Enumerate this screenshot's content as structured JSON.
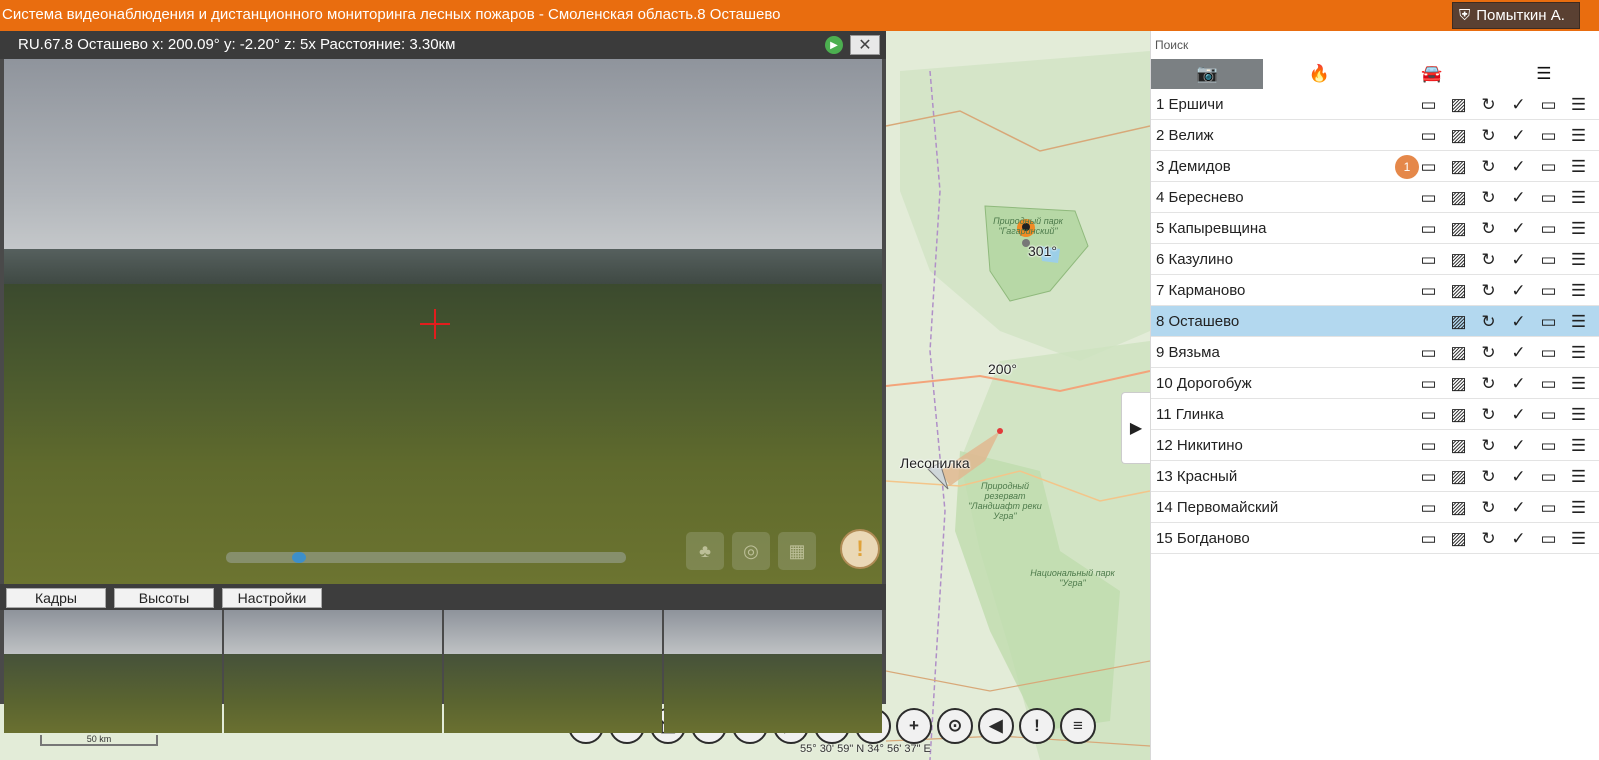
{
  "app": {
    "title": "Система видеонаблюдения и дистанционного мониторинга лесных пожаров - Смоленская область.8 Осташево",
    "user": "Помыткин А.",
    "user_icon": "shield-icon"
  },
  "video": {
    "title": "RU.67.8 Осташево x: 200.09° y: -2.20° z: 5x Расстояние: 3.30км",
    "progress": 0.17,
    "tabs": [
      "Кадры",
      "Высоты",
      "Настройки"
    ]
  },
  "map": {
    "labels": {
      "poi": "Лесопилка",
      "bearing_1": "301°",
      "bearing_2": "200°",
      "park_1": "Природный парк \"Гагаринский\"",
      "reserve": "Природный резерват \"Ландшафт реки Угра\"",
      "park_2": "Национальный парк \"Угра\""
    },
    "scale": "50 km",
    "coords": "55° 30' 59\" N 34° 56' 37\" E"
  },
  "toolbar": [
    {
      "name": "search-tool-button",
      "glyph": "⌕"
    },
    {
      "name": "info-tool-button",
      "glyph": "i"
    },
    {
      "name": "measure-tool-button",
      "glyph": "◺"
    },
    {
      "name": "layers-tool-button",
      "glyph": "≋"
    },
    {
      "name": "2d-toggle-button",
      "glyph": "2D"
    },
    {
      "name": "camera-tool-button",
      "glyph": "▶"
    },
    {
      "name": "fullscreen-button",
      "glyph": "⛶"
    },
    {
      "name": "satellite-tool-button",
      "glyph": "◓"
    },
    {
      "name": "add-point-button",
      "glyph": "+"
    },
    {
      "name": "thermometer-button",
      "glyph": "⊙"
    },
    {
      "name": "sound-button",
      "glyph": "◀"
    },
    {
      "name": "alert-button",
      "glyph": "!"
    },
    {
      "name": "messages-button",
      "glyph": "≡"
    }
  ],
  "panel": {
    "search_label": "Поиск",
    "tabs": [
      {
        "name": "tab-cameras",
        "icon": "camera-icon",
        "glyph": "📷"
      },
      {
        "name": "tab-fires",
        "icon": "fire-icon",
        "glyph": "🔥"
      },
      {
        "name": "tab-vehicles",
        "icon": "car-icon",
        "glyph": "🚘"
      },
      {
        "name": "tab-layers",
        "icon": "layers-icon",
        "glyph": "☰"
      }
    ],
    "selected_index": 7,
    "cameras": [
      {
        "label": "1 Ершичи"
      },
      {
        "label": "2 Велиж"
      },
      {
        "label": "3 Демидов",
        "badge": "1"
      },
      {
        "label": "4 Береснево"
      },
      {
        "label": "5 Капыревщина"
      },
      {
        "label": "6 Казулино"
      },
      {
        "label": "7 Карманово"
      },
      {
        "label": "8 Осташево"
      },
      {
        "label": "9 Вязьма"
      },
      {
        "label": "10 Дорогобуж"
      },
      {
        "label": "11 Глинка"
      },
      {
        "label": "12 Никитино"
      },
      {
        "label": "13 Красный"
      },
      {
        "label": "14 Первомайский"
      },
      {
        "label": "15 Богданово"
      }
    ]
  },
  "colors": {
    "topbar": "#e96d0f",
    "selected_row": "#b3d8ef",
    "badge": "#e5884a"
  }
}
